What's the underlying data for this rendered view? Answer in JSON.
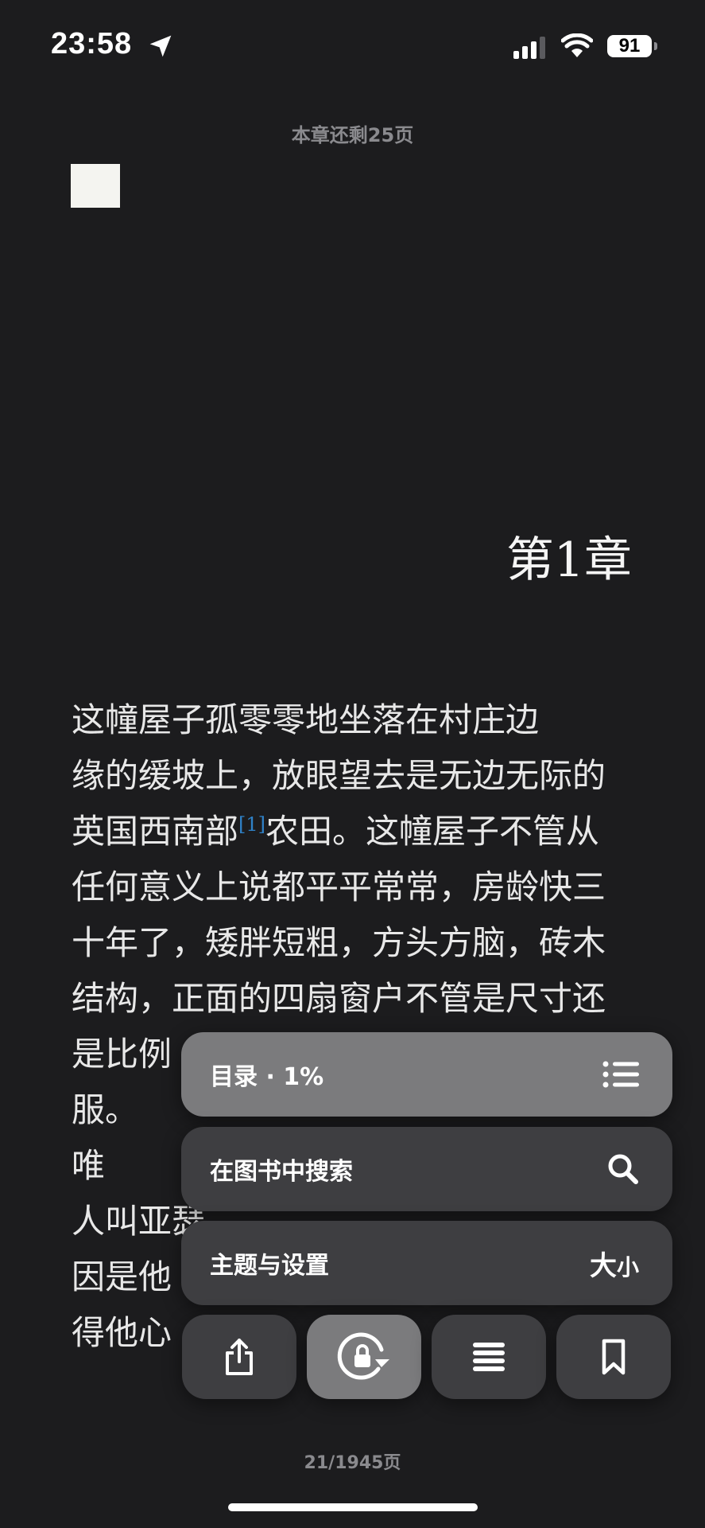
{
  "status_bar": {
    "time": "23:58",
    "battery": "91",
    "icons": [
      "location-arrow-icon",
      "cellular-signal-icon",
      "wifi-icon",
      "battery-icon"
    ]
  },
  "reader": {
    "chapter_remaining": "本章还剩25页",
    "chapter_title": "第1章",
    "paragraph_lines": [
      "    这幢屋子孤零零地坐落在村庄边",
      "缘的缓坡上，放眼望去是无边无际的",
      "英国西南部",
      "任何意义上说都平平常常，房龄快三",
      "十年了，矮胖短粗，方头方脑，砖木",
      "结构，正面的四扇窗户不管是尺寸还",
      "是比例",
      "服。",
      "    唯",
      "人叫亚瑟",
      "因是他",
      "得他心"
    ],
    "line3_footnote": "[1]",
    "line3_rest": "农田。这幢屋子不管从",
    "page_indicator": "21/1945页"
  },
  "menu": {
    "toc_label": "目录 · 1%",
    "search_label": "在图书中搜索",
    "theme_label": "主题与设置",
    "size_big": "大",
    "size_small": "小"
  },
  "actions": [
    "share-icon",
    "rotation-lock-icon",
    "scroll-view-icon",
    "bookmark-icon"
  ]
}
